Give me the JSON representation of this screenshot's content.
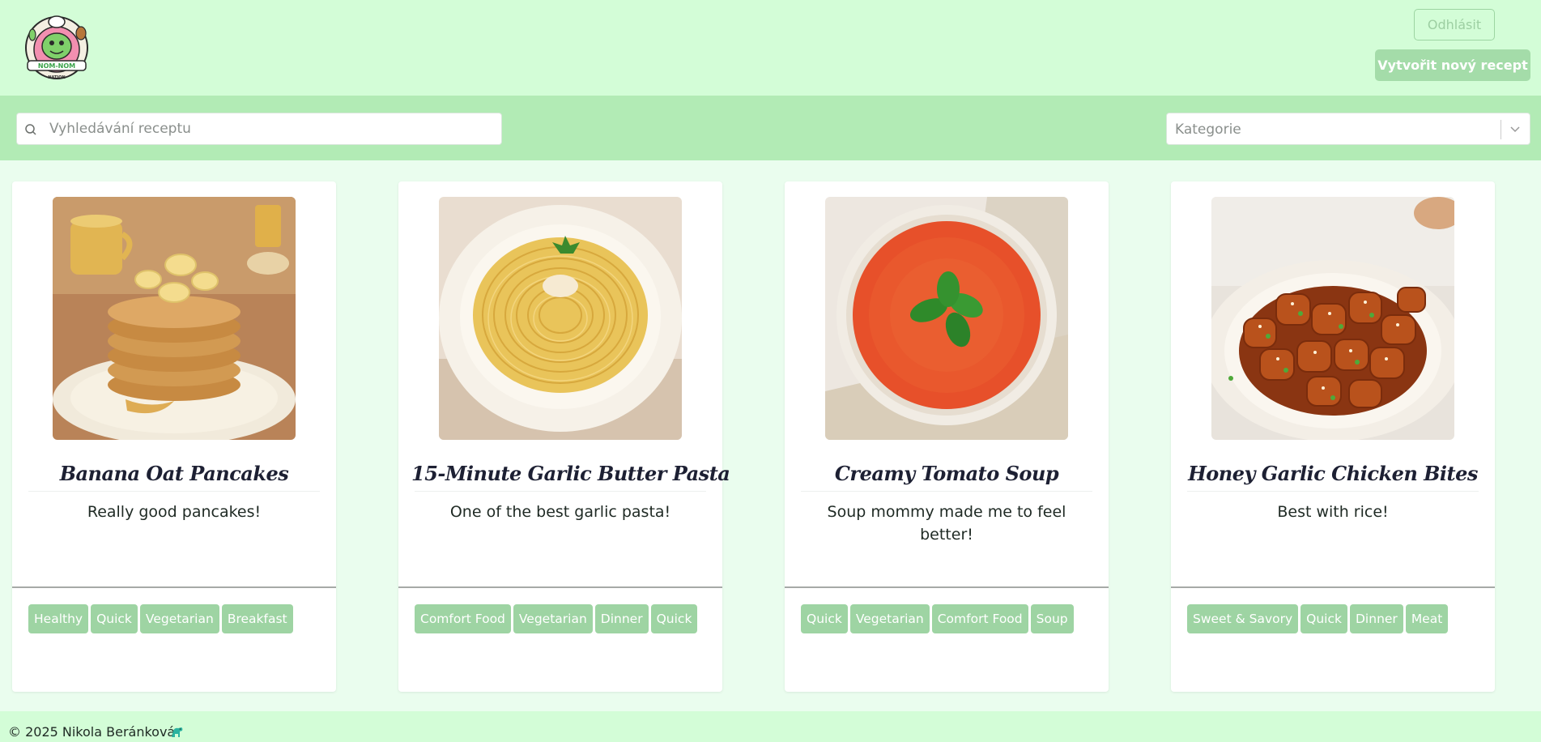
{
  "header": {
    "logo_alt": "NOM-NOM NATION",
    "logout_label": "Odhlásit",
    "new_recipe_label": "Vytvořit nový recept"
  },
  "search": {
    "placeholder": "Vyhledávání receptu",
    "category_placeholder": "Kategorie"
  },
  "recipes": [
    {
      "title": "Banana Oat Pancakes",
      "description": "Really good pancakes!",
      "tags": [
        "Healthy",
        "Quick",
        "Vegetarian",
        "Breakfast"
      ]
    },
    {
      "title": "15-Minute Garlic Butter Pasta",
      "description": "One of the best garlic pasta!",
      "tags": [
        "Comfort Food",
        "Vegetarian",
        "Dinner",
        "Quick"
      ]
    },
    {
      "title": "Creamy Tomato Soup",
      "description": "Soup mommy made me to feel better!",
      "tags": [
        "Quick",
        "Vegetarian",
        "Comfort Food",
        "Soup"
      ]
    },
    {
      "title": "Honey Garlic Chicken Bites",
      "description": "Best with rice!",
      "tags": [
        "Sweet & Savory",
        "Quick",
        "Dinner",
        "Meat"
      ]
    }
  ],
  "footer": {
    "copyright": "© 2025 Nikola Beránková"
  },
  "colors": {
    "header_bg": "#d3fdd7",
    "search_bar_bg": "#b2ebb5",
    "page_bg": "#eafdee",
    "tag_bg": "#9ed4a3",
    "primary_button_bg": "#a4dca9"
  }
}
